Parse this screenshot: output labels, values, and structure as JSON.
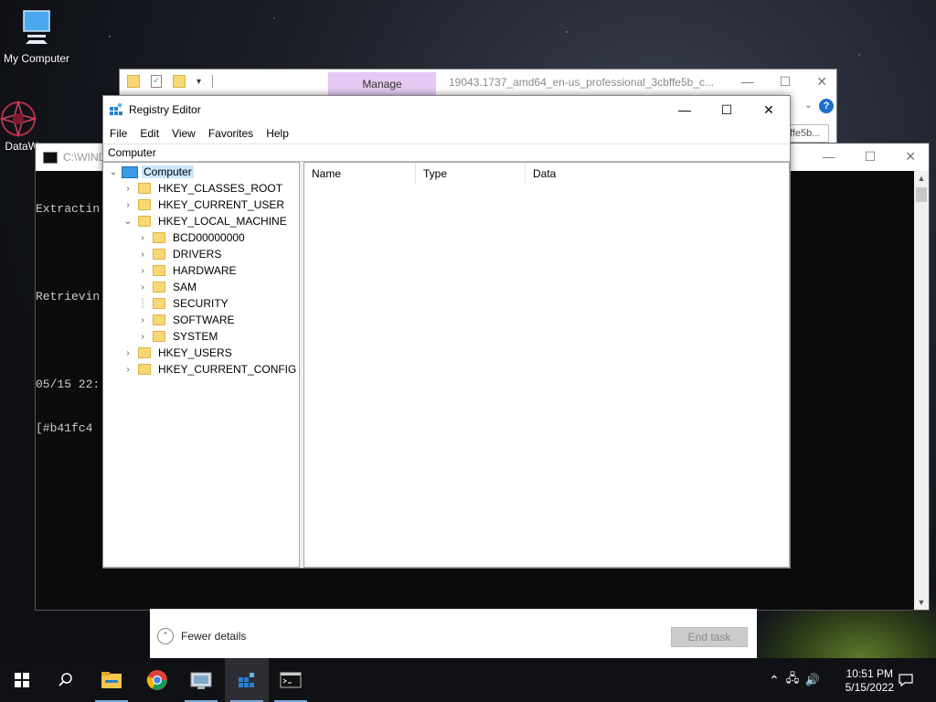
{
  "desktop": {
    "icons": [
      {
        "label": "My Computer",
        "icon": "monitor-icon"
      },
      {
        "label": "DataW",
        "icon": "datawrapper-icon"
      }
    ]
  },
  "explorer": {
    "manage_tab": "Manage",
    "title": "19043.1737_amd64_en-us_professional_3cbffe5b_c...",
    "address_fragment": "ffe5b..."
  },
  "cmd": {
    "title": "C:\\WIND",
    "lines": [
      "Extractin",
      "",
      "Retrievin",
      "",
      "05/15 22:",
      "[#b41fc4"
    ]
  },
  "task_manager": {
    "fewer_details": "Fewer details",
    "end_task": "End task"
  },
  "registry": {
    "title": "Registry Editor",
    "menu": [
      "File",
      "Edit",
      "View",
      "Favorites",
      "Help"
    ],
    "address": "Computer",
    "columns": [
      "Name",
      "Type",
      "Data"
    ],
    "tree": {
      "root": "Computer",
      "hives": [
        {
          "label": "HKEY_CLASSES_ROOT"
        },
        {
          "label": "HKEY_CURRENT_USER"
        },
        {
          "label": "HKEY_LOCAL_MACHINE"
        },
        {
          "label": "HKEY_USERS"
        },
        {
          "label": "HKEY_CURRENT_CONFIG"
        }
      ],
      "hklm_children": [
        {
          "label": "BCD00000000"
        },
        {
          "label": "DRIVERS"
        },
        {
          "label": "HARDWARE"
        },
        {
          "label": "SAM"
        },
        {
          "label": "SECURITY"
        },
        {
          "label": "SOFTWARE"
        },
        {
          "label": "SYSTEM"
        }
      ]
    }
  },
  "taskbar": {
    "apps": [
      "start-icon",
      "search-icon",
      "file-explorer-icon",
      "chrome-icon",
      "system-tool-icon",
      "registry-icon",
      "terminal-icon"
    ],
    "time": "10:51 PM",
    "date": "5/15/2022"
  },
  "colors": {
    "selection": "#cce8ff",
    "folder": "#f8d775",
    "manage_tab": "#e4c9f2"
  }
}
